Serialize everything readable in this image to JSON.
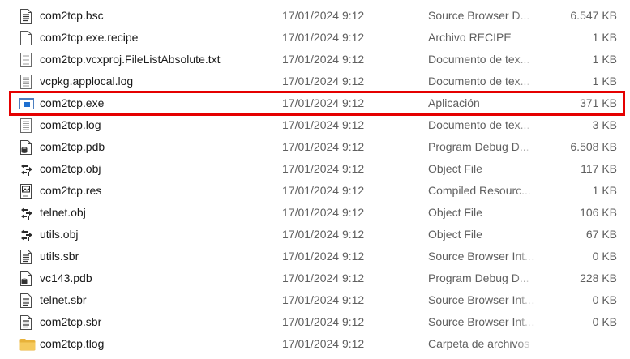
{
  "files": [
    {
      "icon": "document-lines-icon",
      "name": "com2tcp.bsc",
      "date": "17/01/2024 9:12",
      "type": "Source Browser D...",
      "size": "6.547 KB",
      "highlighted": false
    },
    {
      "icon": "blank-file-icon",
      "name": "com2tcp.exe.recipe",
      "date": "17/01/2024 9:12",
      "type": "Archivo RECIPE",
      "size": "1 KB",
      "highlighted": false
    },
    {
      "icon": "text-document-icon",
      "name": "com2tcp.vcxproj.FileListAbsolute.txt",
      "date": "17/01/2024 9:12",
      "type": "Documento de tex...",
      "size": "1 KB",
      "highlighted": false
    },
    {
      "icon": "text-document-icon",
      "name": "vcpkg.applocal.log",
      "date": "17/01/2024 9:12",
      "type": "Documento de tex...",
      "size": "1 KB",
      "highlighted": false
    },
    {
      "icon": "application-window-icon",
      "name": "com2tcp.exe",
      "date": "17/01/2024 9:12",
      "type": "Aplicación",
      "size": "371 KB",
      "highlighted": true
    },
    {
      "icon": "text-document-icon",
      "name": "com2tcp.log",
      "date": "17/01/2024 9:12",
      "type": "Documento de tex...",
      "size": "3 KB",
      "highlighted": false
    },
    {
      "icon": "debug-database-icon",
      "name": "com2tcp.pdb",
      "date": "17/01/2024 9:12",
      "type": "Program Debug D...",
      "size": "6.508 KB",
      "highlighted": false
    },
    {
      "icon": "object-file-icon",
      "name": "com2tcp.obj",
      "date": "17/01/2024 9:12",
      "type": "Object File",
      "size": "117 KB",
      "highlighted": false
    },
    {
      "icon": "compiled-resource-icon",
      "name": "com2tcp.res",
      "date": "17/01/2024 9:12",
      "type": "Compiled Resourc...",
      "size": "1 KB",
      "highlighted": false
    },
    {
      "icon": "object-file-icon",
      "name": "telnet.obj",
      "date": "17/01/2024 9:12",
      "type": "Object File",
      "size": "106 KB",
      "highlighted": false
    },
    {
      "icon": "object-file-icon",
      "name": "utils.obj",
      "date": "17/01/2024 9:12",
      "type": "Object File",
      "size": "67 KB",
      "highlighted": false
    },
    {
      "icon": "document-lines-icon",
      "name": "utils.sbr",
      "date": "17/01/2024 9:12",
      "type": "Source Browser Int...",
      "size": "0 KB",
      "highlighted": false
    },
    {
      "icon": "debug-database-icon",
      "name": "vc143.pdb",
      "date": "17/01/2024 9:12",
      "type": "Program Debug D...",
      "size": "228 KB",
      "highlighted": false
    },
    {
      "icon": "document-lines-icon",
      "name": "telnet.sbr",
      "date": "17/01/2024 9:12",
      "type": "Source Browser Int...",
      "size": "0 KB",
      "highlighted": false
    },
    {
      "icon": "document-lines-icon",
      "name": "com2tcp.sbr",
      "date": "17/01/2024 9:12",
      "type": "Source Browser Int...",
      "size": "0 KB",
      "highlighted": false
    },
    {
      "icon": "folder-icon",
      "name": "com2tcp.tlog",
      "date": "17/01/2024 9:12",
      "type": "Carpeta de archivos",
      "size": "",
      "highlighted": false
    }
  ],
  "colors": {
    "highlight_outline": "#e50000",
    "folder": "#f0c04a",
    "app_accent": "#1e6fd0"
  }
}
